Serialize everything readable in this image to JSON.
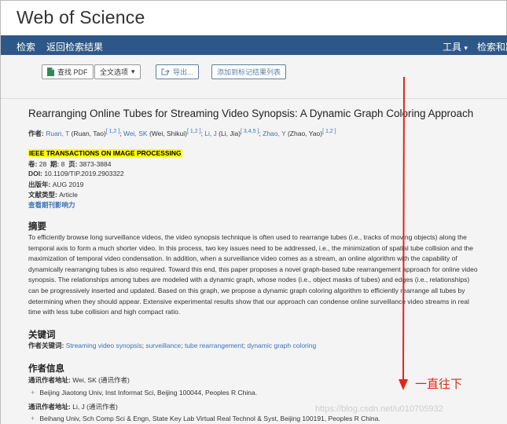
{
  "app": {
    "title": "Web of Science"
  },
  "nav": {
    "search": "检索",
    "back": "返回检索结果",
    "tools": "工具",
    "tools_caret": "▾",
    "right": "检索和跟"
  },
  "toolbar": {
    "find_pdf": "查找 PDF",
    "full_text": "全文选项",
    "full_text_caret": "▾",
    "export": "导出...",
    "add_marked": "添加到标记结果列表"
  },
  "article": {
    "title": "Rearranging Online Tubes for Streaming Video Synopsis: A Dynamic Graph Coloring Approach",
    "authors_label": "作者:",
    "authors": [
      {
        "name": "Ruan, T",
        "full": " (Ruan, Tao)",
        "sup": "[ 1,2 ]",
        "sep": "; "
      },
      {
        "name": "Wei, SK",
        "full": " (Wei, Shikui)",
        "sup": "[ 1,2 ]",
        "sep": "; "
      },
      {
        "name": "Li, J",
        "full": " (Li, Jia)",
        "sup": "[ 3,4,5 ]",
        "sep": "; "
      },
      {
        "name": "Zhao, Y",
        "full": " (Zhao, Yao)",
        "sup": "[ 1,2 ]",
        "sep": ""
      }
    ],
    "journal": "IEEE TRANSACTIONS ON IMAGE PROCESSING",
    "volume_label": "卷:",
    "volume": "28",
    "issue_label": "期:",
    "issue": "8",
    "pages_label": "页:",
    "pages": "3873-3884",
    "doi_label": "DOI:",
    "doi": "10.1109/TIP.2019.2903322",
    "pubdate_label": "出版年:",
    "pubdate": "AUG 2019",
    "doctype_label": "文献类型:",
    "doctype": "Article",
    "impact_link": "查看期刊影响力"
  },
  "abstract": {
    "heading": "摘要",
    "text": "To efficiently browse long surveillance videos, the video synopsis technique is often used to rearrange tubes (i.e., tracks of moving objects) along the temporal axis to form a much shorter video. In this process, two key issues need to be addressed, i.e., the minimization of spatial tube collision and the maximization of temporal video condensation. In addition, when a surveillance video comes as a stream, an online algorithm with the capability of dynamically rearranging tubes is also required. Toward this end, this paper proposes a novel graph-based tube rearrangement approach for online video synopsis. The relationships among tubes are modeled with a dynamic graph, whose nodes (i.e., object masks of tubes) and edges (i.e., relationships) can be progressively inserted and updated. Based on this graph, we propose a dynamic graph coloring algorithm to efficiently rearrange all tubes by determining when they should appear. Extensive experimental results show that our approach can condense online surveillance video streams in real time with less tube collision and high compact ratio."
  },
  "keywords": {
    "heading": "关键词",
    "label": "作者关键词:",
    "items": [
      {
        "text": "Streaming video synopsis",
        "sep": "; "
      },
      {
        "text": "surveillance",
        "sep": "; "
      },
      {
        "text": "tube rearrangement",
        "sep": "; "
      },
      {
        "text": "dynamic graph coloring",
        "sep": ""
      }
    ]
  },
  "author_info": {
    "heading": "作者信息",
    "corr1_label": "通讯作者地址:",
    "corr1_value": "Wei, SK (通讯作者)",
    "addr1": "Beijing Jiaotong Univ, Inst Informat Sci, Beijing 100044, Peoples R China.",
    "corr2_label": "通讯作者地址:",
    "corr2_value": "Li, J (通讯作者)",
    "addr2": "Beihang Univ, Sch Comp Sci & Engn, State Key Lab Virtual Real Technol & Syst, Beijing 100191, Peoples R China."
  },
  "annotation": {
    "text": "一直往下",
    "color": "#e1251b"
  },
  "watermark": "https://blog.csdn.net/u010705932",
  "colors": {
    "nav": "#2d5788",
    "link": "#3b73b5",
    "highlight": "#ffff00"
  }
}
